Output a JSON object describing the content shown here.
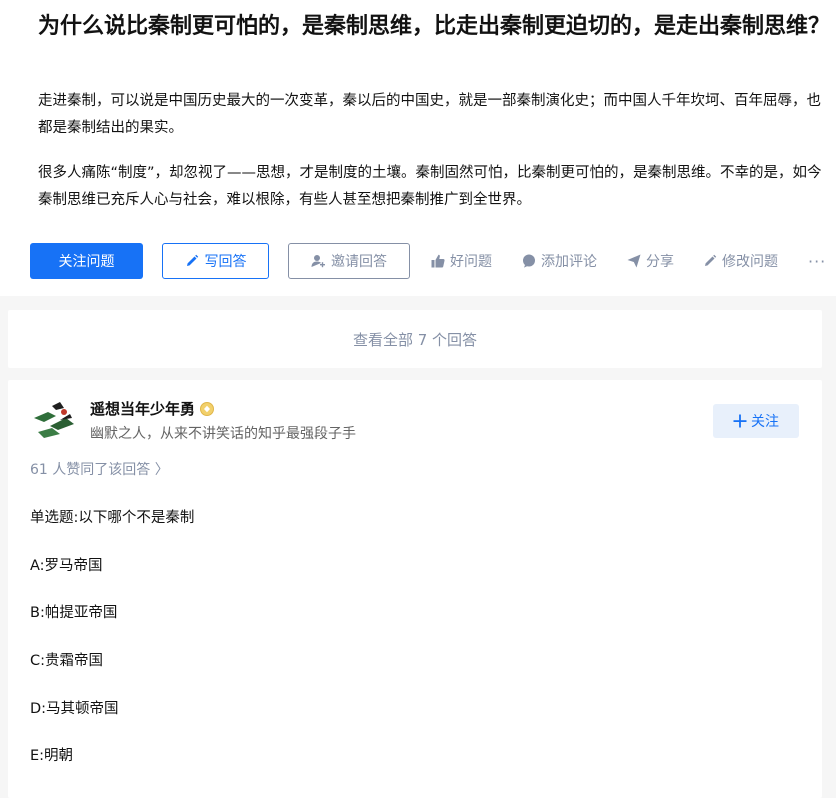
{
  "question": {
    "title": "为什么说比秦制更可怕的，是秦制思维，比走出秦制更迫切的，是走出秦制思维？",
    "description_p1": "走进秦制，可以说是中国历史最大的一次变革，秦以后的中国史，就是一部秦制演化史；而中国人千年坎坷、百年屈辱，也都是秦制结出的果实。",
    "description_p2": "很多人痛陈“制度”，却忽视了——思想，才是制度的土壤。秦制固然可怕，比秦制更可怕的，是秦制思维。不幸的是，如今秦制思维已充斥人心与社会，难以根除，有些人甚至想把秦制推广到全世界。"
  },
  "actions": {
    "follow_label": "关注问题",
    "write_label": "写回答",
    "invite_label": "邀请回答",
    "good_label": "好问题",
    "comment_label": "添加评论",
    "share_label": "分享",
    "edit_label": "修改问题",
    "more_label": "···"
  },
  "view_all": {
    "label": "查看全部 7 个回答"
  },
  "answer": {
    "author_name": "遥想当年少年勇",
    "author_bio": "幽默之人，从来不讲笑话的知乎最强段子手",
    "follow_label": "关注",
    "voters_text": "61 人赞同了该回答 〉",
    "lines": [
      "单选题:以下哪个不是秦制",
      "A:罗马帝国",
      "B:帕提亚帝国",
      "C:贵霜帝国",
      "D:马其顿帝国",
      "E:明朝"
    ]
  },
  "colors": {
    "brand_blue": "#1772f6",
    "muted_gray": "#8590a6",
    "background": "#f6f6f6"
  },
  "icons": {
    "write": "pencil-icon",
    "invite": "person-add-icon",
    "good": "thumb-up-icon",
    "comment": "comment-bubble-icon",
    "share": "paper-plane-icon",
    "edit": "pencil-icon",
    "follow_author": "plus-icon",
    "badge": "badge-icon"
  }
}
